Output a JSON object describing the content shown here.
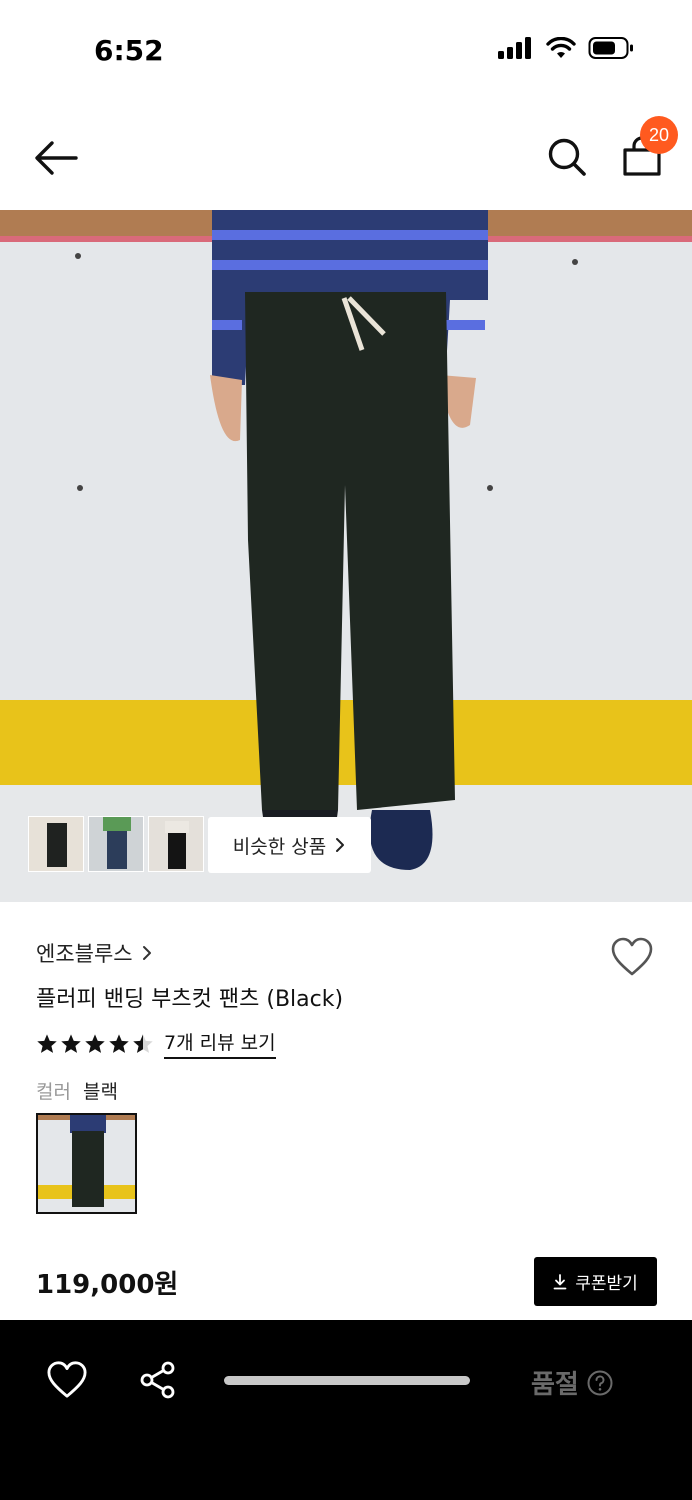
{
  "status_bar": {
    "time": "6:52"
  },
  "nav": {
    "cart_count": "20"
  },
  "gallery": {
    "similar_label": "비슷한 상품"
  },
  "product": {
    "brand": "엔조블루스",
    "title": "플러피 밴딩 부츠컷 팬츠 (Black)",
    "rating": 4.5,
    "review_link": "7개 리뷰 보기",
    "color_label": "컬러",
    "color_value": "블랙",
    "price": "119,000원",
    "coupon_label": "쿠폰받기"
  },
  "bottom_bar": {
    "soldout_label": "품절"
  },
  "icons": [
    "back-arrow-icon",
    "search-icon",
    "shopping-bag-icon",
    "chevron-right-icon",
    "heart-icon",
    "star-icon",
    "download-icon",
    "share-icon",
    "question-icon"
  ],
  "colors": {
    "badge": "#ff5a1f",
    "button": "#000000",
    "bottom_bar": "#000000"
  }
}
